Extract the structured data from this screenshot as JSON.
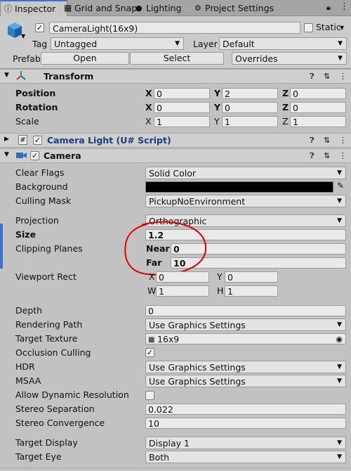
{
  "tabs": [
    {
      "label": "Inspector",
      "icon": "info-icon"
    },
    {
      "label": "Grid and Snap",
      "icon": "grid-icon"
    },
    {
      "label": "Lighting",
      "icon": "light-bulb-icon"
    },
    {
      "label": "Project Settings",
      "icon": "gear-icon"
    }
  ],
  "header": {
    "object_name": "CameraLight(16x9)",
    "static_label": "Static",
    "tag_label": "Tag",
    "tag_value": "Untagged",
    "layer_label": "Layer",
    "layer_value": "Default",
    "prefab_label": "Prefab",
    "open_label": "Open",
    "select_label": "Select",
    "overrides_label": "Overrides"
  },
  "transform": {
    "title": "Transform",
    "rows": [
      {
        "label": "Position",
        "x": "0",
        "y": "2",
        "z": "0"
      },
      {
        "label": "Rotation",
        "x": "0",
        "y": "0",
        "z": "0"
      },
      {
        "label": "Scale",
        "x": "1",
        "y": "1",
        "z": "1"
      }
    ]
  },
  "script": {
    "title": "Camera Light (U# Script)"
  },
  "camera": {
    "title": "Camera",
    "clear_flags_label": "Clear Flags",
    "clear_flags_value": "Solid Color",
    "background_label": "Background",
    "culling_mask_label": "Culling Mask",
    "culling_mask_value": "PickupNoEnvironment",
    "projection_label": "Projection",
    "projection_value": "Orthographic",
    "size_label": "Size",
    "size_value": "1.2",
    "clipping_label": "Clipping Planes",
    "near_label": "Near",
    "near_value": "0",
    "far_label": "Far",
    "far_value": "10",
    "viewport_label": "Viewport Rect",
    "viewport": {
      "x": "0",
      "y": "0",
      "w": "1",
      "h": "1"
    },
    "depth_label": "Depth",
    "depth_value": "0",
    "rendering_path_label": "Rendering Path",
    "rendering_path_value": "Use Graphics Settings",
    "target_texture_label": "Target Texture",
    "target_texture_value": "16x9",
    "occlusion_label": "Occlusion Culling",
    "hdr_label": "HDR",
    "hdr_value": "Use Graphics Settings",
    "msaa_label": "MSAA",
    "msaa_value": "Use Graphics Settings",
    "dynres_label": "Allow Dynamic Resolution",
    "stereo_sep_label": "Stereo Separation",
    "stereo_sep_value": "0.022",
    "stereo_conv_label": "Stereo Convergence",
    "stereo_conv_value": "10",
    "target_display_label": "Target Display",
    "target_display_value": "Display 1",
    "target_eye_label": "Target Eye",
    "target_eye_value": "Both"
  },
  "colors": {
    "accent": "#3a72c8",
    "annotation": "#e00000",
    "background_swatch": "#000000"
  }
}
